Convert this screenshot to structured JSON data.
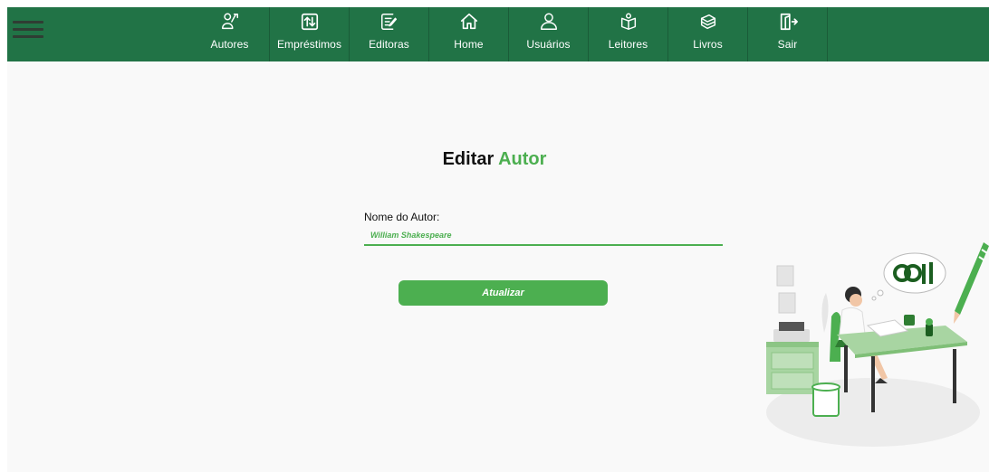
{
  "nav": {
    "items": [
      {
        "label": "Autores",
        "icon": "author-icon"
      },
      {
        "label": "Empréstimos",
        "icon": "exchange-icon"
      },
      {
        "label": "Editoras",
        "icon": "edit-note-icon"
      },
      {
        "label": "Home",
        "icon": "home-icon"
      },
      {
        "label": "Usuários",
        "icon": "user-icon"
      },
      {
        "label": "Leitores",
        "icon": "reader-icon"
      },
      {
        "label": "Livros",
        "icon": "books-icon"
      },
      {
        "label": "Sair",
        "icon": "logout-icon"
      }
    ]
  },
  "form": {
    "title_main": "Editar",
    "title_accent": "Autor",
    "name_label": "Nome do Autor:",
    "name_value": "William Shakespeare",
    "submit_label": "Atualizar"
  },
  "colors": {
    "navbar": "#217346",
    "accent": "#4caf50"
  }
}
